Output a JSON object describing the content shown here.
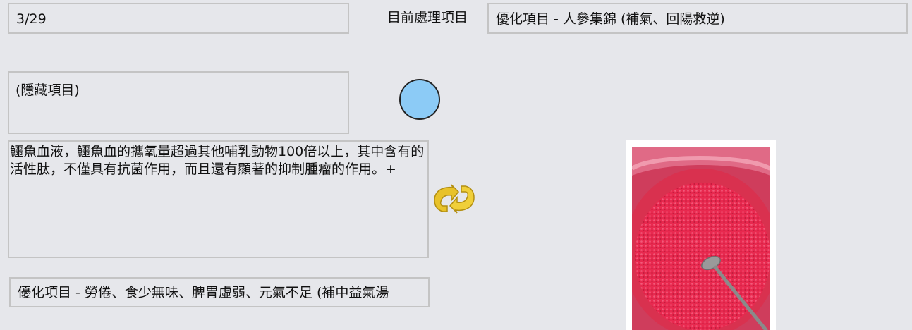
{
  "counter": "3/29",
  "current_label": "目前處理項目",
  "current_item": "優化項目 - 人參集錦 (補氣、回陽救逆)",
  "hidden_item": "(隱藏項目)",
  "description": "鱷魚血液，鱷魚血的攜氧量超過其他哺乳動物100倍以上，其中含有的活性肽，不僅具有抗菌作用，而且還有顯著的抑制腫瘤的作用。+",
  "option_item": "優化項目 - 勞倦、食少無味、脾胃虛弱、元氣不足 (補中益氣湯",
  "icons": {
    "status_circle": "circle-indicator-icon",
    "refresh": "refresh-icon",
    "photo": "red-powder-bowl-photo"
  },
  "colors": {
    "background": "#e6e7eb",
    "circle": "#8ccbf6",
    "refresh": "#e8c22a"
  }
}
